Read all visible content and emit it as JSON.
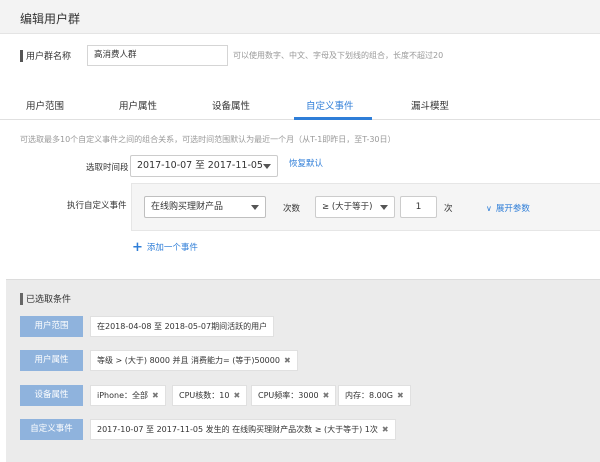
{
  "header": {
    "title": "编辑用户群"
  },
  "group_name": {
    "label": "用户群名称",
    "value": "高消费人群",
    "hint": "可以使用数字、中文、字母及下划线的组合，长度不超过20"
  },
  "tabs": [
    {
      "label": "用户范围"
    },
    {
      "label": "用户属性"
    },
    {
      "label": "设备属性"
    },
    {
      "label": "自定义事件"
    },
    {
      "label": "漏斗模型"
    }
  ],
  "active_tab": "自定义事件",
  "colors": {
    "accent": "#2f7ed8",
    "condition_label": "#8fb3dd"
  },
  "custom_event": {
    "info": "可选取最多10个自定义事件之间的组合关系，可选时间范围默认为最近一个月（从T-1即昨日，至T-30日）",
    "date_label": "选取时间段",
    "date_range": "2017-10-07 至 2017-11-05",
    "reset_label": "恢复默认",
    "event_label": "执行自定义事件",
    "event_value": "在线购买理财产品",
    "count_label": "次数",
    "operator_value": "≥ (大于等于)",
    "count_value": "1",
    "count_unit": "次",
    "expand_label": "展开参数",
    "add_label": "添加一个事件"
  },
  "selected": {
    "title": "已选取条件",
    "conditions": [
      {
        "label": "用户范围",
        "chips": [
          {
            "text": "在2018-04-08 至 2018-05-07期间活跃的用户",
            "removable": false
          }
        ]
      },
      {
        "label": "用户属性",
        "chips": [
          {
            "text": "等级 > (大于) 8000 并且 消费能力= (等于)50000",
            "removable": true
          }
        ]
      },
      {
        "label": "设备属性",
        "chips": [
          {
            "text": "iPhone：全部",
            "removable": true
          },
          {
            "text": "CPU核数：10",
            "removable": true
          },
          {
            "text": "CPU频率：3000",
            "removable": true
          },
          {
            "text": "内存：8.00G",
            "removable": true
          }
        ]
      },
      {
        "label": "自定义事件",
        "chips": [
          {
            "text": "2017-10-07 至 2017-11-05 发生的 在线购买理财产品次数 ≥ (大于等于) 1次",
            "removable": true
          }
        ]
      }
    ]
  }
}
